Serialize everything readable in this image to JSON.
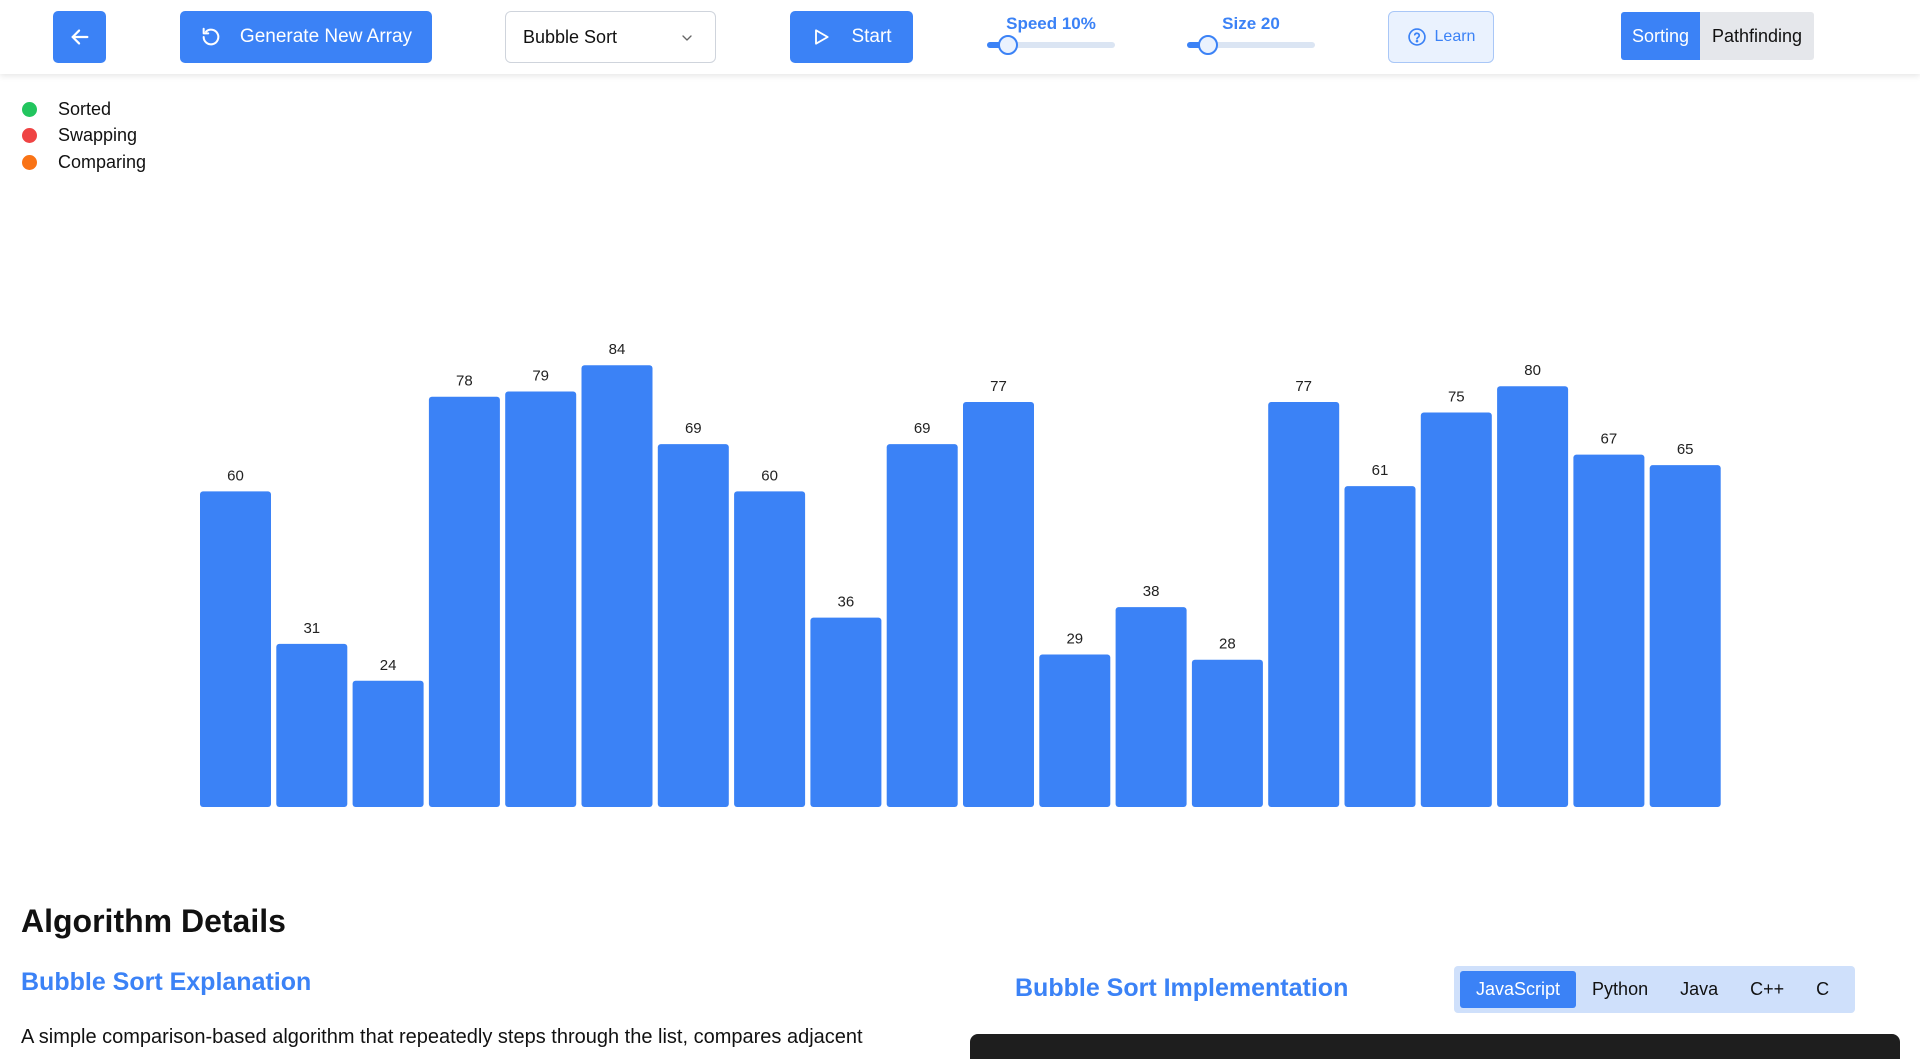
{
  "toolbar": {
    "generate_label": "Generate New Array",
    "algorithm_selected": "Bubble Sort",
    "start_label": "Start",
    "speed_label": "Speed 10%",
    "speed_value": 0.1,
    "size_label": "Size 20",
    "size_value": 0.1,
    "learn_label": "Learn",
    "modes": [
      {
        "label": "Sorting",
        "active": true
      },
      {
        "label": "Pathfinding",
        "active": false
      }
    ]
  },
  "legend": [
    {
      "label": "Sorted",
      "color": "#22c55e"
    },
    {
      "label": "Swapping",
      "color": "#ef4444"
    },
    {
      "label": "Comparing",
      "color": "#f97316"
    }
  ],
  "chart_data": {
    "type": "bar",
    "values": [
      60,
      31,
      24,
      78,
      79,
      84,
      69,
      60,
      36,
      69,
      77,
      29,
      38,
      28,
      77,
      61,
      75,
      80,
      67,
      65
    ],
    "bar_color": "#3b82f6"
  },
  "details": {
    "title": "Algorithm Details",
    "explanation_title": "Bubble Sort Explanation",
    "explanation_text": "A simple comparison-based algorithm that repeatedly steps through the list, compares adjacent",
    "implementation_title": "Bubble Sort Implementation",
    "languages": [
      {
        "label": "JavaScript",
        "active": true
      },
      {
        "label": "Python",
        "active": false
      },
      {
        "label": "Java",
        "active": false
      },
      {
        "label": "C++",
        "active": false
      },
      {
        "label": "C",
        "active": false
      }
    ]
  }
}
